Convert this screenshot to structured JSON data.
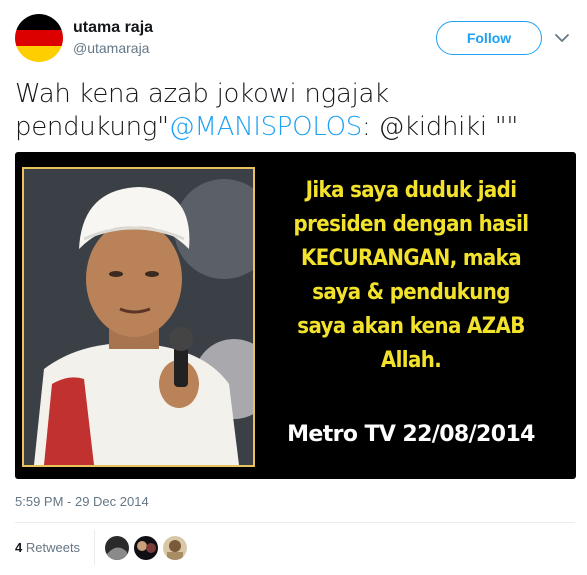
{
  "user": {
    "display_name": "utama raja",
    "handle": "@utamaraja"
  },
  "follow_button": {
    "label": "Follow"
  },
  "tweet": {
    "text_line1": "Wah kena azab jokowi ngajak",
    "text_line2_prefix": "pendukung\"",
    "mention_1": "@MANISPOLOS",
    "text_line2_suffix": ": @kidhiki \"\""
  },
  "media_image": {
    "quote_text": "Jika saya duduk jadi\npresiden dengan hasil\nKECURANGAN, maka\nsaya & pendukung\nsaya akan kena AZAB\nAllah.",
    "source_text": "Metro TV 22/08/2014",
    "quote_color": "#f2e22c"
  },
  "timestamp": "5:59 PM - 29 Dec 2014",
  "stats": {
    "retweet_count": "4",
    "retweet_label": "Retweets"
  },
  "colors": {
    "accent": "#1da1f2",
    "secondary_text": "#657786"
  }
}
